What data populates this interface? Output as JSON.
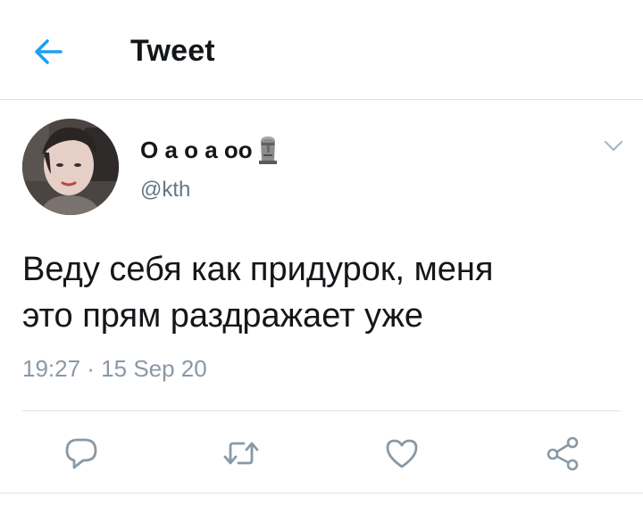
{
  "header": {
    "title": "Tweet",
    "back_icon": "arrow-left-icon",
    "accent": "#1da1f2"
  },
  "author": {
    "display_name": "O a o a oo",
    "name_emoji": "moai-icon",
    "handle": "@kth"
  },
  "tweet": {
    "text_lines": [
      "Веду себя как придурок, меня",
      "это прям раздражает уже"
    ],
    "timestamp": "19:27 · 15 Sep 20"
  },
  "actions": [
    {
      "name": "reply",
      "icon": "reply-icon"
    },
    {
      "name": "retweet",
      "icon": "retweet-icon"
    },
    {
      "name": "like",
      "icon": "heart-icon"
    },
    {
      "name": "share",
      "icon": "share-icon"
    }
  ],
  "colors": {
    "text": "#14171a",
    "secondary": "#657786",
    "icon": "#8899a6",
    "divider": "#dfe3e6"
  }
}
